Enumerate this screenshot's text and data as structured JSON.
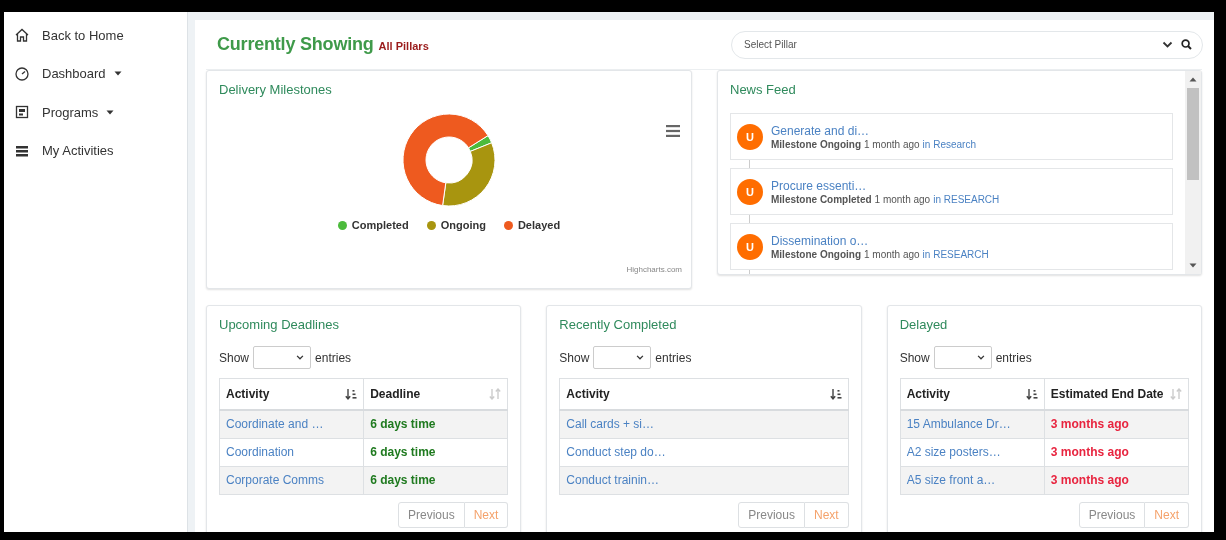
{
  "sidebar": {
    "items": [
      {
        "label": "Back to Home",
        "kind": "home",
        "dropdown": false
      },
      {
        "label": "Dashboard",
        "kind": "gauge",
        "dropdown": true
      },
      {
        "label": "Programs",
        "kind": "board",
        "dropdown": true
      },
      {
        "label": "My Activities",
        "kind": "list",
        "dropdown": false
      }
    ]
  },
  "header": {
    "title": "Currently Showing",
    "filter": "All Pillars"
  },
  "pillar_select": {
    "placeholder": "Select Pillar"
  },
  "delivery_milestones": {
    "title": "Delivery Milestones",
    "credit": "Highcharts.com",
    "legend": [
      {
        "label": "Completed",
        "color": "#4cbb3c"
      },
      {
        "label": "Ongoing",
        "color": "#a8950f"
      },
      {
        "label": "Delayed",
        "color": "#ee5a1f"
      }
    ]
  },
  "news_feed": {
    "title": "News Feed",
    "items": [
      {
        "avatar": "U",
        "title": "Generate and di…",
        "status": "Milestone Ongoing",
        "time": "1 month ago",
        "pillar": "in Research"
      },
      {
        "avatar": "U",
        "title": "Procure essenti…",
        "status": "Milestone Completed",
        "time": "1 month ago",
        "pillar": "in RESEARCH"
      },
      {
        "avatar": "U",
        "title": "Dissemination o…",
        "status": "Milestone Ongoing",
        "time": "1 month ago",
        "pillar": "in RESEARCH"
      }
    ]
  },
  "tables": [
    {
      "title": "Upcoming Deadlines",
      "show_label": "Show",
      "entries_label": "entries",
      "columns": [
        {
          "label": "Activity",
          "kind": "link",
          "sorted": true
        },
        {
          "label": "Deadline",
          "kind": "due",
          "sorted": false
        }
      ],
      "rows": [
        [
          "Coordinate and …",
          "6 days time"
        ],
        [
          "Coordination",
          "6 days time"
        ],
        [
          "Corporate Comms",
          "6 days time"
        ]
      ],
      "pager": {
        "previous": "Previous",
        "next": "Next"
      }
    },
    {
      "title": "Recently Completed",
      "show_label": "Show",
      "entries_label": "entries",
      "columns": [
        {
          "label": "Activity",
          "kind": "link",
          "sorted": true
        }
      ],
      "rows": [
        [
          "Call cards + si…"
        ],
        [
          "Conduct step do…"
        ],
        [
          "Conduct trainin…"
        ]
      ],
      "pager": {
        "previous": "Previous",
        "next": "Next"
      }
    },
    {
      "title": "Delayed",
      "show_label": "Show",
      "entries_label": "entries",
      "columns": [
        {
          "label": "Activity",
          "kind": "link",
          "sorted": true
        },
        {
          "label": "Estimated End Date",
          "kind": "overdue",
          "sorted": false
        }
      ],
      "rows": [
        [
          "15 Ambulance Dr…",
          "3 months ago"
        ],
        [
          "A2 size posters…",
          "3 months ago"
        ],
        [
          "A5 size front a…",
          "3 months ago"
        ]
      ],
      "pager": {
        "previous": "Previous",
        "next": "Next"
      }
    }
  ]
}
